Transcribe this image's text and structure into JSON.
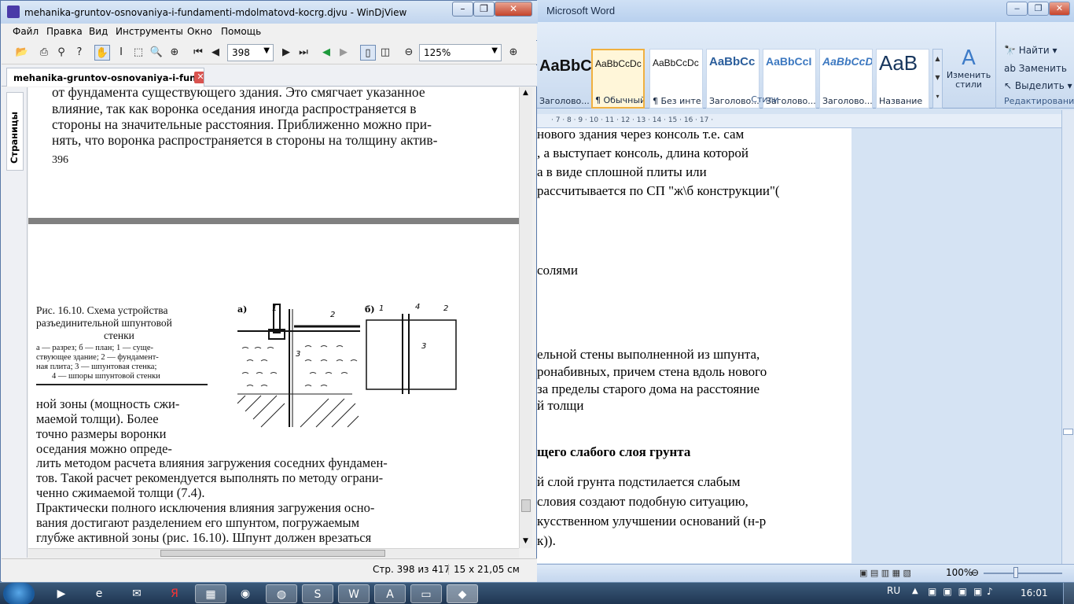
{
  "word": {
    "title": "Microsoft Word",
    "styles": [
      {
        "sample": "AaBbC",
        "name": "Заголово..."
      },
      {
        "sample": "AaBbCcDc",
        "name": "¶ Обычный"
      },
      {
        "sample": "AaBbCcDc",
        "name": "¶ Без инте..."
      },
      {
        "sample": "AaBbCc",
        "name": "Заголово..."
      },
      {
        "sample": "AaBbCcI",
        "name": "Заголово..."
      },
      {
        "sample": "AaBbCcD",
        "name": "Заголово..."
      },
      {
        "sample": "AaB",
        "name": "Название"
      }
    ],
    "change_styles": "Изменить стили",
    "styles_group": "Стили",
    "find": "Найти",
    "replace": "Заменить",
    "select": "Выделить",
    "editing_group": "Редактирование",
    "ruler": "· 7 · 8 · 9 · 10 · 11 · 12 · 13 · 14 · 15 · 16 · 17 ·",
    "lines": [
      "нового здания через консоль т.е. сам",
      ", а выступает консоль, длина которой",
      "а в виде сплошной плиты  или",
      "рассчитывается по СП \"ж\\б конструкции\"(",
      "солями",
      "ельной стены выполненной из шпунта,",
      "ронабивных, причем стена вдоль нового",
      " за пределы старого дома на расстояние",
      "й толщи",
      "щего слабого слоя грунта",
      "й слой грунта подстилается слабым",
      "словия создают подобную ситуацию,",
      "кусственном улучшении оснований (н-р",
      "к))."
    ],
    "zoom": "100%"
  },
  "djview": {
    "title": "mehanika-gruntov-osnovaniya-i-fundamenti-mdolmatovd-kocrg.djvu - WinDjView",
    "menu": [
      "Файл",
      "Правка",
      "Вид",
      "Инструменты",
      "Окно",
      "Помощь"
    ],
    "page_input": "398",
    "zoom_input": "125%",
    "tab_label": "mehanika-gruntov-osnovaniya-i-fun...",
    "side_tab": "Страницы",
    "page_top_lines": [
      "от фундамента существующего здания. Это смягчает указанное",
      "влияние, так как воронка оседания иногда распространяется в",
      "стороны на значительные расстояния. Приближенно можно при-",
      "нять, что воронка распространяется в стороны на толщину актив-"
    ],
    "page_number": "396",
    "figure_caption": [
      "Рис. 16.10. Схема устройства",
      "разъединительной      шпунтовой",
      "стенки"
    ],
    "figure_legend": [
      "а — разрез;   б — план;   1 — суще-",
      "ствующее здание;  2 — фундамент-",
      "ная плита;  3 — шпунтовая стенка;",
      "4 — шпоры шпунтовой стенки"
    ],
    "figure_labels": {
      "a": "а)",
      "b": "б)",
      "n1": "1",
      "n2": "2",
      "n3": "3",
      "n4": "4"
    },
    "body_lines": [
      "ной зоны (мощность сжи-",
      "маемой толщи).  Более",
      "точно  размеры  воронки",
      "оседания  можно  опреде-",
      "лить методом расчета влияния загружения соседних фундамен-",
      "тов. Такой расчет рекомендуется выполнять по методу ограни-",
      "ченно сжимаемой толщи (7.4).",
      "    Практически полного исключения влияния загружения осно-",
      "вания  достигают  разделением  его  шпунтом,  погружаемым",
      "глубже активной зоны (рис. 16.10). Шпунт должен врезаться"
    ],
    "status_page": "Стр. 398 из 417",
    "status_size": "15 x 21,05 см"
  },
  "taskbar": {
    "lang": "RU",
    "time": "16:01"
  }
}
